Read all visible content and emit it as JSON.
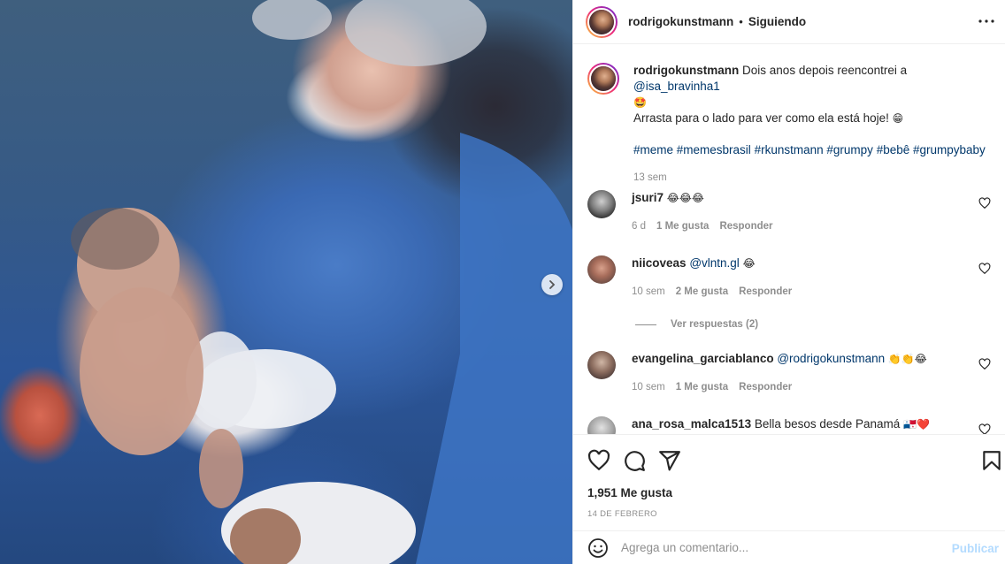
{
  "post": {
    "username": "rodrigokunstmann",
    "separator": "•",
    "follow_status": "Siguiendo",
    "caption": {
      "username": "rodrigokunstmann",
      "text_before": "Dois anos depois reencontrei a ",
      "mention": "@isa_bravinha1",
      "emoji_1": "🤩",
      "line2": "Arrasta para o lado para ver como ela está hoje! ",
      "emoji_2": "😁",
      "hashtags": [
        "#meme",
        "#memesbrasil",
        "#rkunstmann",
        "#grumpy",
        "#bebê",
        "#grumpybaby"
      ],
      "time": "13 sem"
    }
  },
  "comments": [
    {
      "username": "jsuri7",
      "mention": "",
      "text": "",
      "emojis": "😂😂😂",
      "time": "6 d",
      "likes": "1 Me gusta",
      "reply": "Responder"
    },
    {
      "username": "niicoveas",
      "mention": "@vlntn.gl",
      "text": "",
      "emojis": "😂",
      "time": "10 sem",
      "likes": "2 Me gusta",
      "reply": "Responder"
    },
    {
      "username": "evangelina_garciablanco",
      "mention": "@rodrigokunstmann",
      "text": "",
      "emojis": "👏👏😂",
      "time": "10 sem",
      "likes": "1 Me gusta",
      "reply": "Responder"
    },
    {
      "username": "ana_rosa_malca1513",
      "mention": "",
      "text": "Bella besos desde Panamá ",
      "emojis": "🇵🇦❤️",
      "time": "",
      "likes": "",
      "reply": ""
    }
  ],
  "view_replies": "Ver respuestas (2)",
  "likes_count": "1,951 Me gusta",
  "post_date": "14 DE FEBRERO",
  "add_comment": {
    "placeholder": "Agrega un comentario...",
    "publish": "Publicar"
  },
  "colors": {
    "link": "#00376b",
    "muted": "#8e8e8e",
    "publish_disabled": "#b3dbff"
  },
  "icons": [
    "chevron-right-icon",
    "more-icon",
    "heart-icon",
    "comment-icon",
    "share-icon",
    "bookmark-icon",
    "emoji-icon"
  ]
}
